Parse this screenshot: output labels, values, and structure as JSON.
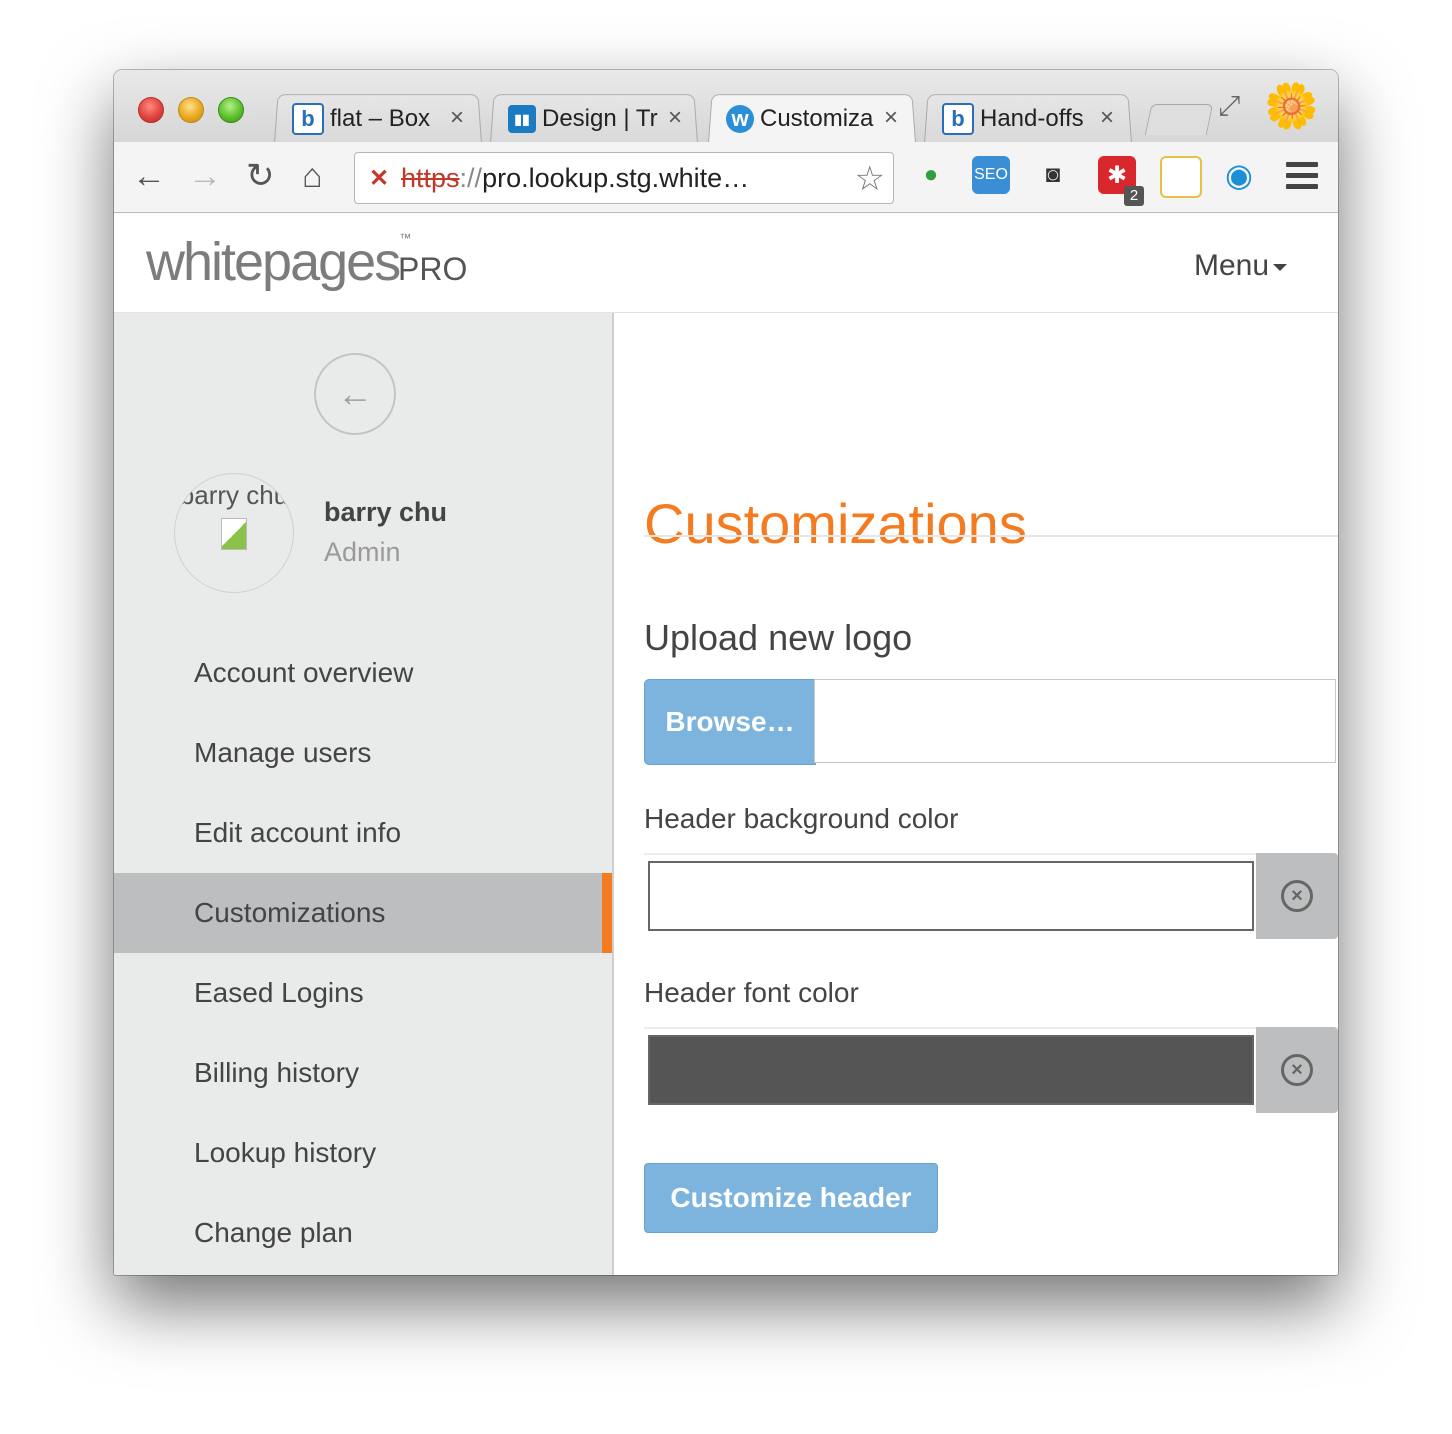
{
  "browser": {
    "tabs": [
      {
        "icon": "box-icon",
        "icon_letter": "b",
        "title": "flat – Box",
        "close": "×"
      },
      {
        "icon": "trello-icon",
        "icon_letter": "▮▮",
        "title": "Design | Tr",
        "close": "×"
      },
      {
        "icon": "whitepages-icon",
        "icon_letter": "w",
        "title": "Customiza",
        "close": "×"
      },
      {
        "icon": "box-icon",
        "icon_letter": "b",
        "title": "Hand-offs",
        "close": "×"
      }
    ],
    "url_scheme": "https",
    "url_sep": "://",
    "url_rest": "pro.lookup.stg.white…",
    "ext_badge": "2"
  },
  "header": {
    "logo_text": "whitepages",
    "logo_tm": "™",
    "logo_pro": "PRO",
    "menu_label": "Menu"
  },
  "sidebar": {
    "avatar_alt": "barry chu",
    "user_name": "barry chu",
    "user_role": "Admin",
    "items": [
      {
        "label": "Account overview"
      },
      {
        "label": "Manage users"
      },
      {
        "label": "Edit account info"
      },
      {
        "label": "Customizations",
        "active": true
      },
      {
        "label": "Eased Logins"
      },
      {
        "label": "Billing history"
      },
      {
        "label": "Lookup history"
      },
      {
        "label": "Change plan"
      }
    ]
  },
  "main": {
    "title": "Customizations",
    "upload_label": "Upload new logo",
    "browse_label": "Browse…",
    "bg_color_label": "Header background color",
    "bg_color_value": "#ffffff",
    "font_color_label": "Header font color",
    "font_color_value": "#555555",
    "submit_label": "Customize header"
  },
  "colors": {
    "accent": "#f47b20",
    "button_blue": "#7db4de",
    "sidebar_bg": "#e9eaea",
    "active_item_bg": "#bdbebf"
  }
}
